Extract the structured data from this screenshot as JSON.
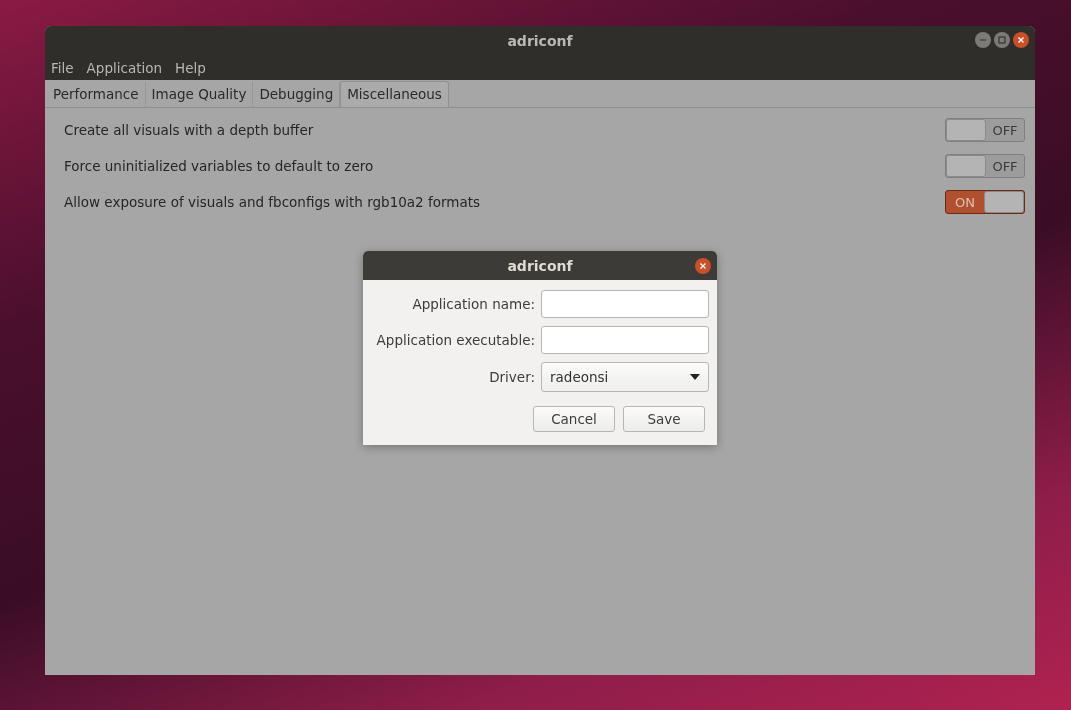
{
  "window": {
    "title": "adriconf"
  },
  "menu": [
    "File",
    "Application",
    "Help"
  ],
  "tabs": [
    {
      "label": "Performance",
      "selected": false
    },
    {
      "label": "Image Quality",
      "selected": false
    },
    {
      "label": "Debugging",
      "selected": false
    },
    {
      "label": "Miscellaneous",
      "selected": true
    }
  ],
  "options": [
    {
      "label": "Create all visuals with a depth buffer",
      "on": false,
      "state_text": "OFF"
    },
    {
      "label": "Force uninitialized variables to default to zero",
      "on": false,
      "state_text": "OFF"
    },
    {
      "label": "Allow exposure of visuals and fbconfigs with rgb10a2 formats",
      "on": true,
      "state_text": "ON"
    }
  ],
  "dialog": {
    "title": "adriconf",
    "fields": [
      {
        "kind": "text",
        "label": "Application name:"
      },
      {
        "kind": "text",
        "label": "Application executable:"
      },
      {
        "kind": "dropdown",
        "label": "Driver:",
        "value": "radeonsi"
      }
    ],
    "buttons": [
      "Cancel",
      "Save"
    ]
  }
}
